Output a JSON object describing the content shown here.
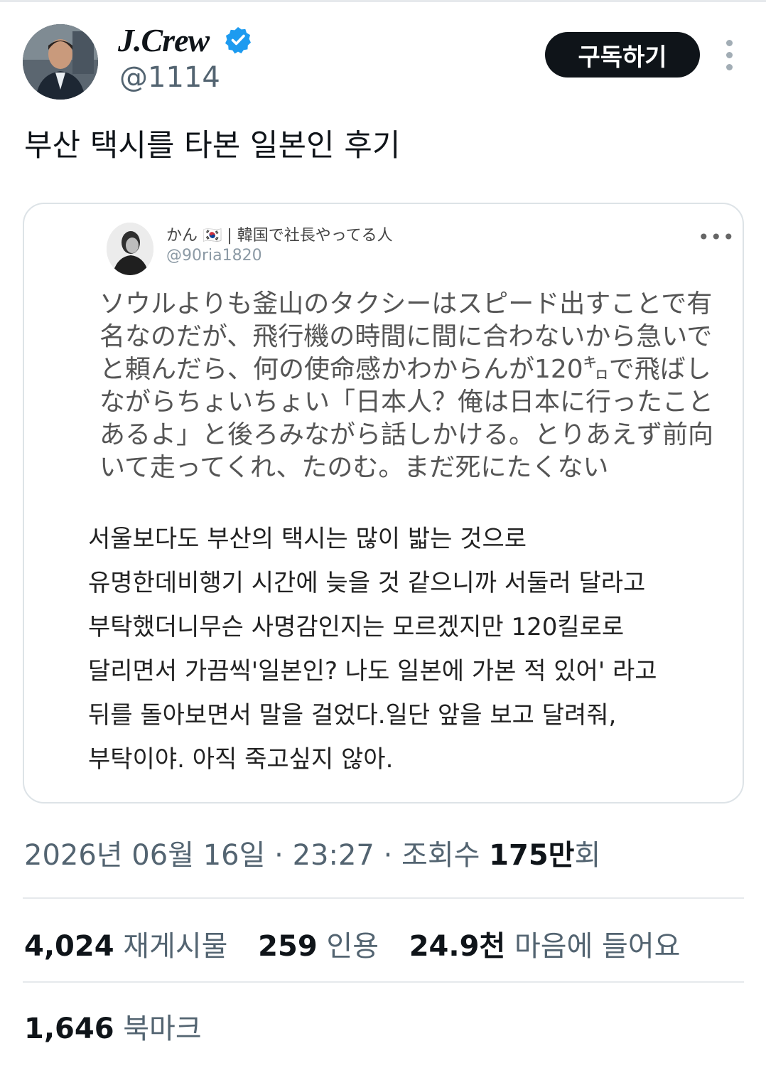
{
  "author": {
    "display_name": "J.Crew",
    "handle": "@1114",
    "verified_icon": "verified-badge-icon"
  },
  "header": {
    "subscribe_label": "구독하기",
    "more_icon": "more-vertical-icon"
  },
  "tweet": {
    "text": "부산 택시를 타본 일본인 후기"
  },
  "quoted": {
    "name": "かん 🇰🇷 | 韓国で社長やってる人",
    "handle": "@90ria1820",
    "more": "•••",
    "jp_text": "ソウルよりも釜山のタクシーはスピード出すことで有\n名なのだが、飛行機の時間に間に合わないから急いで\nと頼んだら、何の使命感かわからんが120㌔で飛ばし\nながらちょいちょい「日本人？俺は日本に行ったこと\nあるよ」と後ろみながら話しかける。とりあえず前向\nいて走ってくれ、たのむ。まだ死にたくない",
    "kr_text": "서울보다도 부산의 택시는 많이 밟는 것으로\n유명한데비행기 시간에 늦을 것 같으니까 서둘러 달라고\n부탁했더니무슨 사명감인지는 모르겠지만 120킬로로\n달리면서 가끔씩'일본인? 나도 일본에 가본 적 있어' 라고\n뒤를 돌아보면서 말을 걸었다.일단 앞을 보고 달려줘,\n부탁이야. 아직 죽고싶지 않아."
  },
  "meta": {
    "date": "2026년 06월 16일",
    "separator": "·",
    "time": "23:27",
    "views_label": "조회수",
    "views_count": "175만",
    "views_suffix": "회"
  },
  "stats": {
    "reposts_count": "4,024",
    "reposts_label": "재게시물",
    "quotes_count": "259",
    "quotes_label": "인용",
    "likes_count": "24.9천",
    "likes_label": "마음에 들어요",
    "bookmarks_count": "1,646",
    "bookmarks_label": "북마크"
  },
  "colors": {
    "verified": "#1d9bf0",
    "button_bg": "#0f1419",
    "secondary_text": "#536471",
    "divider": "#e6e9ec"
  }
}
